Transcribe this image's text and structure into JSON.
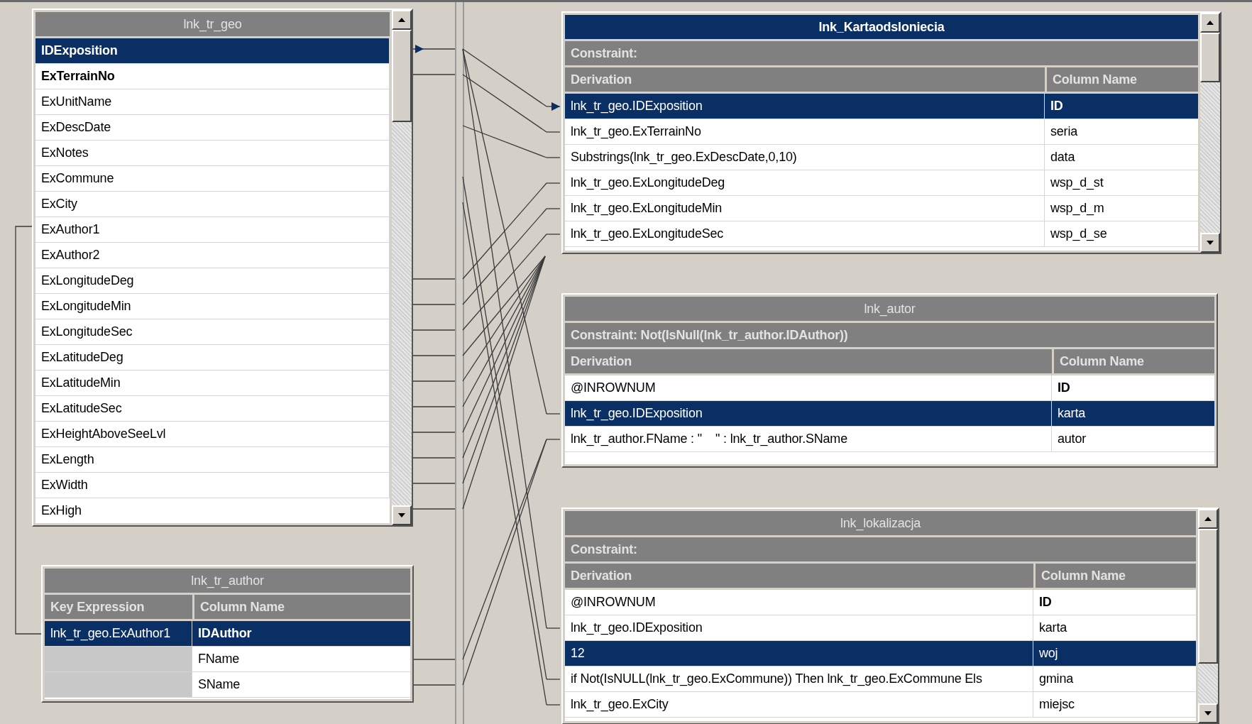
{
  "tables": [
    {
      "kind": "source",
      "title": "lnk_tr_geo",
      "active": false,
      "scrollbar": true,
      "rows": [
        {
          "column": "IDExposition",
          "key": true,
          "selected": true
        },
        {
          "column": "ExTerrainNo",
          "key": true,
          "selected": false
        },
        {
          "column": "ExUnitName",
          "key": false,
          "selected": false
        },
        {
          "column": "ExDescDate",
          "key": false,
          "selected": false
        },
        {
          "column": "ExNotes",
          "key": false,
          "selected": false
        },
        {
          "column": "ExCommune",
          "key": false,
          "selected": false
        },
        {
          "column": "ExCity",
          "key": false,
          "selected": false
        },
        {
          "column": "ExAuthor1",
          "key": false,
          "selected": false
        },
        {
          "column": "ExAuthor2",
          "key": false,
          "selected": false
        },
        {
          "column": "ExLongitudeDeg",
          "key": false,
          "selected": false
        },
        {
          "column": "ExLongitudeMin",
          "key": false,
          "selected": false
        },
        {
          "column": "ExLongitudeSec",
          "key": false,
          "selected": false
        },
        {
          "column": "ExLatitudeDeg",
          "key": false,
          "selected": false
        },
        {
          "column": "ExLatitudeMin",
          "key": false,
          "selected": false
        },
        {
          "column": "ExLatitudeSec",
          "key": false,
          "selected": false
        },
        {
          "column": "ExHeightAboveSeeLvl",
          "key": false,
          "selected": false
        },
        {
          "column": "ExLength",
          "key": false,
          "selected": false
        },
        {
          "column": "ExWidth",
          "key": false,
          "selected": false
        },
        {
          "column": "ExHigh",
          "key": false,
          "selected": false
        }
      ]
    },
    {
      "kind": "lookup",
      "title": "lnk_tr_author",
      "active": false,
      "scrollbar": false,
      "headers": [
        "Key Expression",
        "Column Name"
      ],
      "rows": [
        {
          "key_expression": "lnk_tr_geo.ExAuthor1",
          "column_name": "IDAuthor",
          "key": true,
          "selected": true
        },
        {
          "column_name": "FName",
          "key": false,
          "selected": false
        },
        {
          "column_name": "SName",
          "key": false,
          "selected": false
        }
      ]
    },
    {
      "kind": "target",
      "title": "lnk_Kartaodsloniecia",
      "active": true,
      "scrollbar": true,
      "constraint": "Constraint:",
      "headers": [
        "Derivation",
        "Column Name"
      ],
      "rows": [
        {
          "derivation": "lnk_tr_geo.IDExposition",
          "column_name": "ID",
          "key": true,
          "selected": true
        },
        {
          "derivation": "lnk_tr_geo.ExTerrainNo",
          "column_name": "seria",
          "key": false,
          "selected": false
        },
        {
          "derivation": "Substrings(lnk_tr_geo.ExDescDate,0,10)",
          "column_name": "data",
          "key": false,
          "selected": false
        },
        {
          "derivation": "lnk_tr_geo.ExLongitudeDeg",
          "column_name": "wsp_d_st",
          "key": false,
          "selected": false
        },
        {
          "derivation": "lnk_tr_geo.ExLongitudeMin",
          "column_name": "wsp_d_m",
          "key": false,
          "selected": false
        },
        {
          "derivation": "lnk_tr_geo.ExLongitudeSec",
          "column_name": "wsp_d_se",
          "key": false,
          "selected": false
        }
      ]
    },
    {
      "kind": "target",
      "title": "lnk_autor",
      "active": false,
      "scrollbar": false,
      "constraint": "Constraint: Not(IsNull(lnk_tr_author.IDAuthor))",
      "headers": [
        "Derivation",
        "Column Name"
      ],
      "rows": [
        {
          "derivation": "@INROWNUM",
          "column_name": "ID",
          "key": true,
          "selected": false
        },
        {
          "derivation": "lnk_tr_geo.IDExposition",
          "column_name": "karta",
          "key": false,
          "selected": true
        },
        {
          "derivation": "lnk_tr_author.FName : \"    \" : lnk_tr_author.SName",
          "column_name": "autor",
          "key": false,
          "selected": false
        }
      ]
    },
    {
      "kind": "target",
      "title": "lnk_lokalizacja",
      "active": false,
      "scrollbar": true,
      "constraint": "Constraint:",
      "headers": [
        "Derivation",
        "Column Name"
      ],
      "rows": [
        {
          "derivation": "@INROWNUM",
          "column_name": "ID",
          "key": true,
          "selected": false
        },
        {
          "derivation": "lnk_tr_geo.IDExposition",
          "column_name": "karta",
          "key": false,
          "selected": false
        },
        {
          "derivation": "12",
          "column_name": "woj",
          "key": false,
          "selected": true
        },
        {
          "derivation": "if Not(IsNULL(lnk_tr_geo.ExCommune)) Then lnk_tr_geo.ExCommune Els",
          "column_name": "gmina",
          "key": false,
          "selected": false
        },
        {
          "derivation": "lnk_tr_geo.ExCity",
          "column_name": "miejsc",
          "key": false,
          "selected": false
        }
      ]
    }
  ]
}
